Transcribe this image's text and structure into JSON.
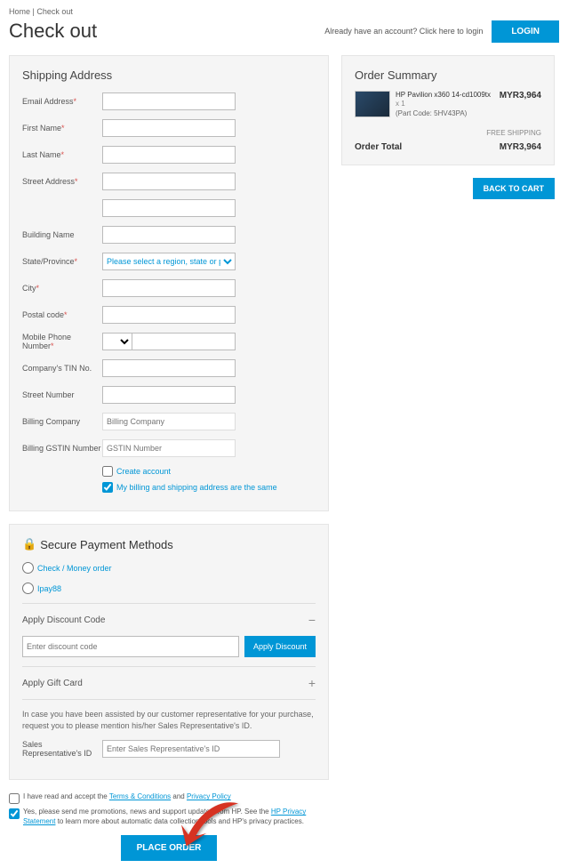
{
  "breadcrumb": {
    "home": "Home",
    "sep": "|",
    "current": "Check out"
  },
  "page_title": "Check out",
  "header": {
    "login_prompt": "Already have an account? Click here to login",
    "login_btn": "LOGIN"
  },
  "shipping": {
    "title": "Shipping Address",
    "email": "Email Address",
    "first_name": "First Name",
    "last_name": "Last Name",
    "street": "Street Address",
    "building": "Building Name",
    "state": "State/Province",
    "state_placeholder": "Please select a region, state or province.",
    "city": "City",
    "postal": "Postal code",
    "phone": "Mobile Phone Number",
    "tin": "Company's TIN No.",
    "street_num": "Street Number",
    "billing_company": "Billing Company",
    "billing_company_ph": "Billing Company",
    "billing_gstin": "Billing GSTIN Number",
    "billing_gstin_ph": "GSTIN Number",
    "create_account": "Create account",
    "same_address": "My billing and shipping address are the same"
  },
  "payment": {
    "title": "Secure Payment Methods",
    "check": "Check / Money order",
    "ipay": "Ipay88",
    "discount_title": "Apply Discount Code",
    "discount_ph": "Enter discount code",
    "apply_btn": "Apply Discount",
    "gift_title": "Apply Gift Card",
    "assist_text": "In case you have been assisted by our customer representative for your purchase, request you to please mention his/her Sales Representative's ID.",
    "rep_label": "Sales Representative's ID",
    "rep_ph": "Enter Sales Representative's ID"
  },
  "terms": {
    "accept_pre": "I have read and accept the ",
    "tc": "Terms & Conditions",
    "and": " and ",
    "pp": "Privacy Policy",
    "promo_pre": "Yes, please send me promotions, news and support updates from HP. See the ",
    "hp_privacy": "HP Privacy Statement",
    "promo_post": " to learn more about automatic data collection tools and HP's privacy practices."
  },
  "place_order": "PLACE ORDER",
  "summary": {
    "title": "Order Summary",
    "product_name": "HP Pavilion x360 14-cd1009tx",
    "qty": "x 1",
    "part": "(Part Code: 5HV43PA)",
    "price": "MYR3,964",
    "free_ship": "FREE SHIPPING",
    "total_label": "Order Total",
    "total_value": "MYR3,964",
    "back_btn": "BACK TO CART"
  }
}
